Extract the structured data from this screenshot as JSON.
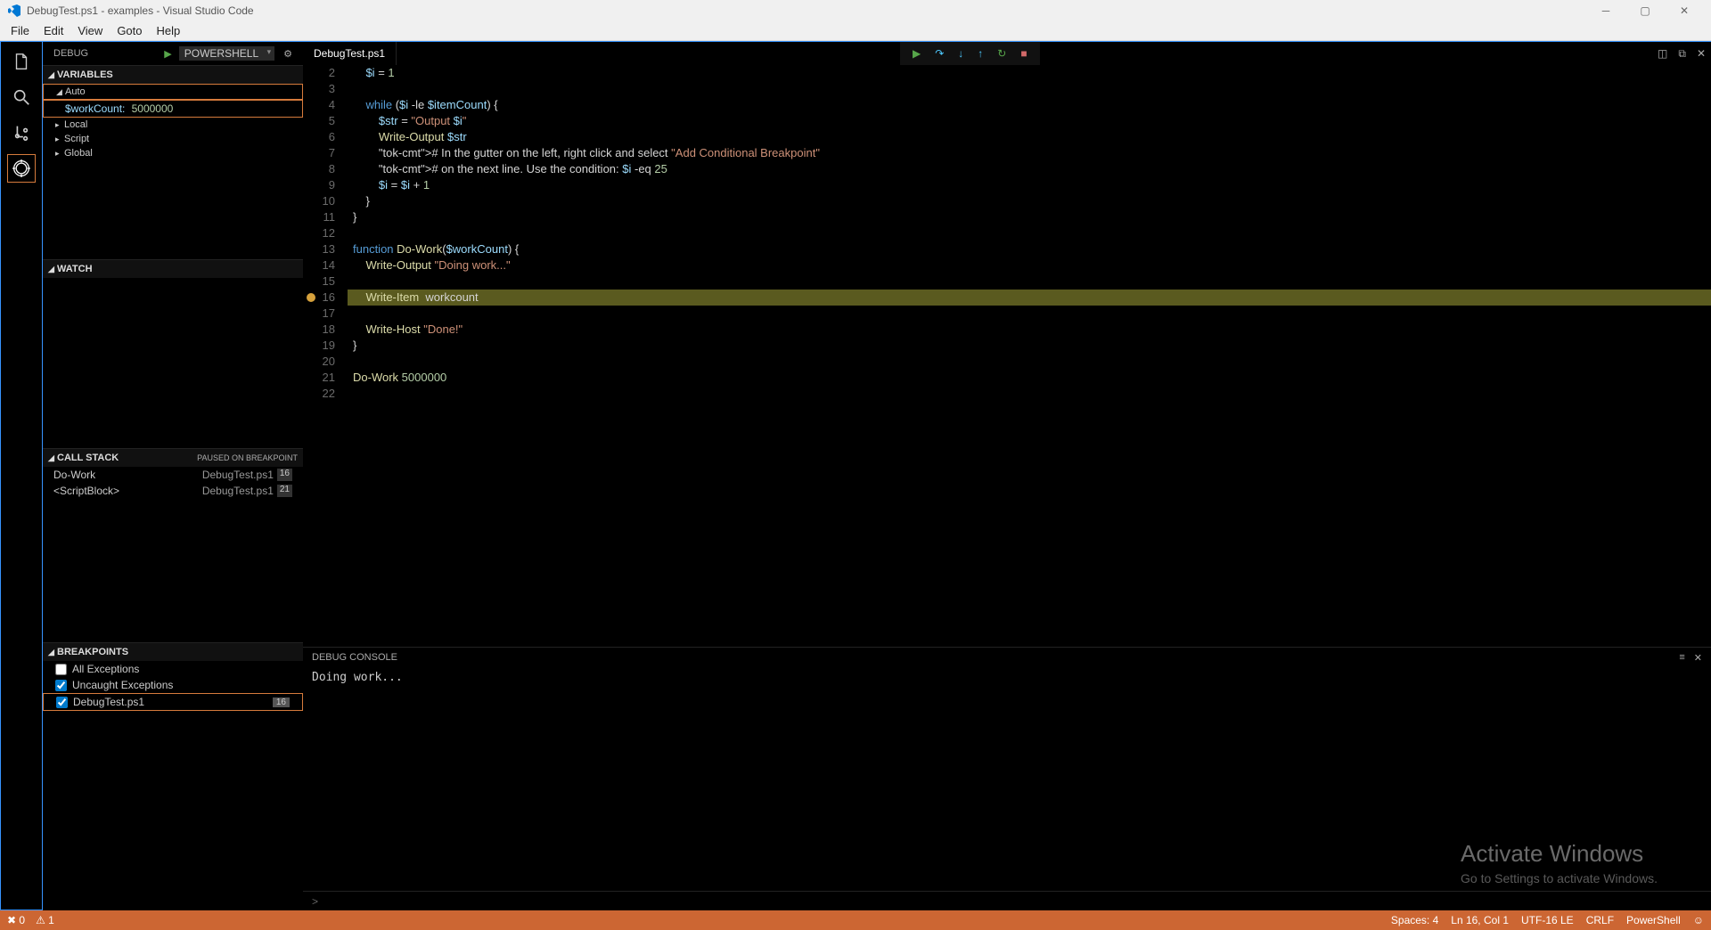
{
  "title": "DebugTest.ps1 - examples - Visual Studio Code",
  "menu": [
    "File",
    "Edit",
    "View",
    "Goto",
    "Help"
  ],
  "debugHead": {
    "label": "DEBUG",
    "config": "PowerShell"
  },
  "variables": {
    "header": "VARIABLES",
    "groups": [
      "Auto",
      "Local",
      "Script",
      "Global"
    ],
    "item": {
      "name": "$workCount:",
      "value": "5000000"
    }
  },
  "watch": {
    "header": "WATCH"
  },
  "callStack": {
    "header": "CALL STACK",
    "status": "PAUSED ON BREAKPOINT",
    "rows": [
      {
        "fn": "Do-Work",
        "file": "DebugTest.ps1",
        "line": "16"
      },
      {
        "fn": "<ScriptBlock>",
        "file": "DebugTest.ps1",
        "line": "21"
      }
    ]
  },
  "breakpoints": {
    "header": "BREAKPOINTS",
    "rows": [
      {
        "label": "All Exceptions",
        "checked": false
      },
      {
        "label": "Uncaught Exceptions",
        "checked": true
      },
      {
        "label": "DebugTest.ps1",
        "checked": true,
        "line": "16"
      }
    ]
  },
  "editorTab": "DebugTest.ps1",
  "code": {
    "start": 2,
    "lines": [
      "    $i = 1",
      "",
      "    while ($i -le $itemCount) {",
      "        $str = \"Output $i\"",
      "        Write-Output $str",
      "        # In the gutter on the left, right click and select \"Add Conditional Breakpoint\"",
      "        # on the next line. Use the condition: $i -eq 25",
      "        $i = $i + 1",
      "    }",
      "}",
      "",
      "function Do-Work($workCount) {",
      "    Write-Output \"Doing work...\"",
      "",
      "    Write-Item  workcount",
      "",
      "    Write-Host \"Done!\"",
      "}",
      "",
      "Do-Work 5000000",
      ""
    ],
    "highlight": 16,
    "breakpoint": 16
  },
  "console": {
    "header": "DEBUG CONSOLE",
    "output": "Doing work...",
    "prompt": ">"
  },
  "status": {
    "left": [
      "✖ 0",
      "⚠ 1"
    ],
    "right": [
      "Spaces: 4",
      "Ln 16, Col 1",
      "UTF-16 LE",
      "CRLF",
      "PowerShell",
      "☺"
    ]
  },
  "watermark": {
    "t1": "Activate Windows",
    "t2": "Go to Settings to activate Windows."
  }
}
